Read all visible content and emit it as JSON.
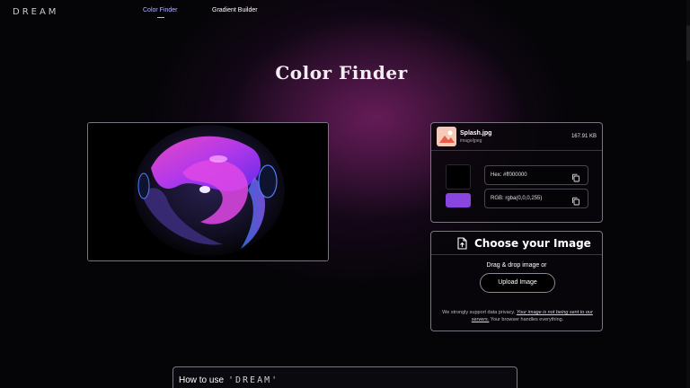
{
  "brand": {
    "logo": "DREAM"
  },
  "nav": {
    "items": [
      {
        "label": "Color Finder",
        "active": true
      },
      {
        "label": "Gradient Builder",
        "active": false
      }
    ]
  },
  "page": {
    "title": "Color Finder"
  },
  "preview": {
    "image": "abstract-3d-sphere-artwork"
  },
  "file": {
    "name": "Splash.jpg",
    "type": "image/jpeg",
    "size": "167.91 KB"
  },
  "colors": {
    "hex_label": "Hex: #ff000000",
    "rgb_label": "RGB: rgba(0,0,0,255)",
    "swatch_hex_color": "#000000",
    "swatch_rgb_color": "#8845e0"
  },
  "upload": {
    "title": "Choose your Image",
    "drag_text": "Drag & drop image or",
    "button_label": "Upload Image",
    "privacy_prefix": "We strongly support data privacy.",
    "privacy_emphasis": "Your image is not being sent to our servers.",
    "privacy_suffix": "Your browser handles everything."
  },
  "howto": {
    "title": "How to use",
    "brand": "'DREAM'"
  },
  "theme": {
    "accent": "#b3b8ff",
    "border": "#7a7580",
    "background": "#050407"
  }
}
